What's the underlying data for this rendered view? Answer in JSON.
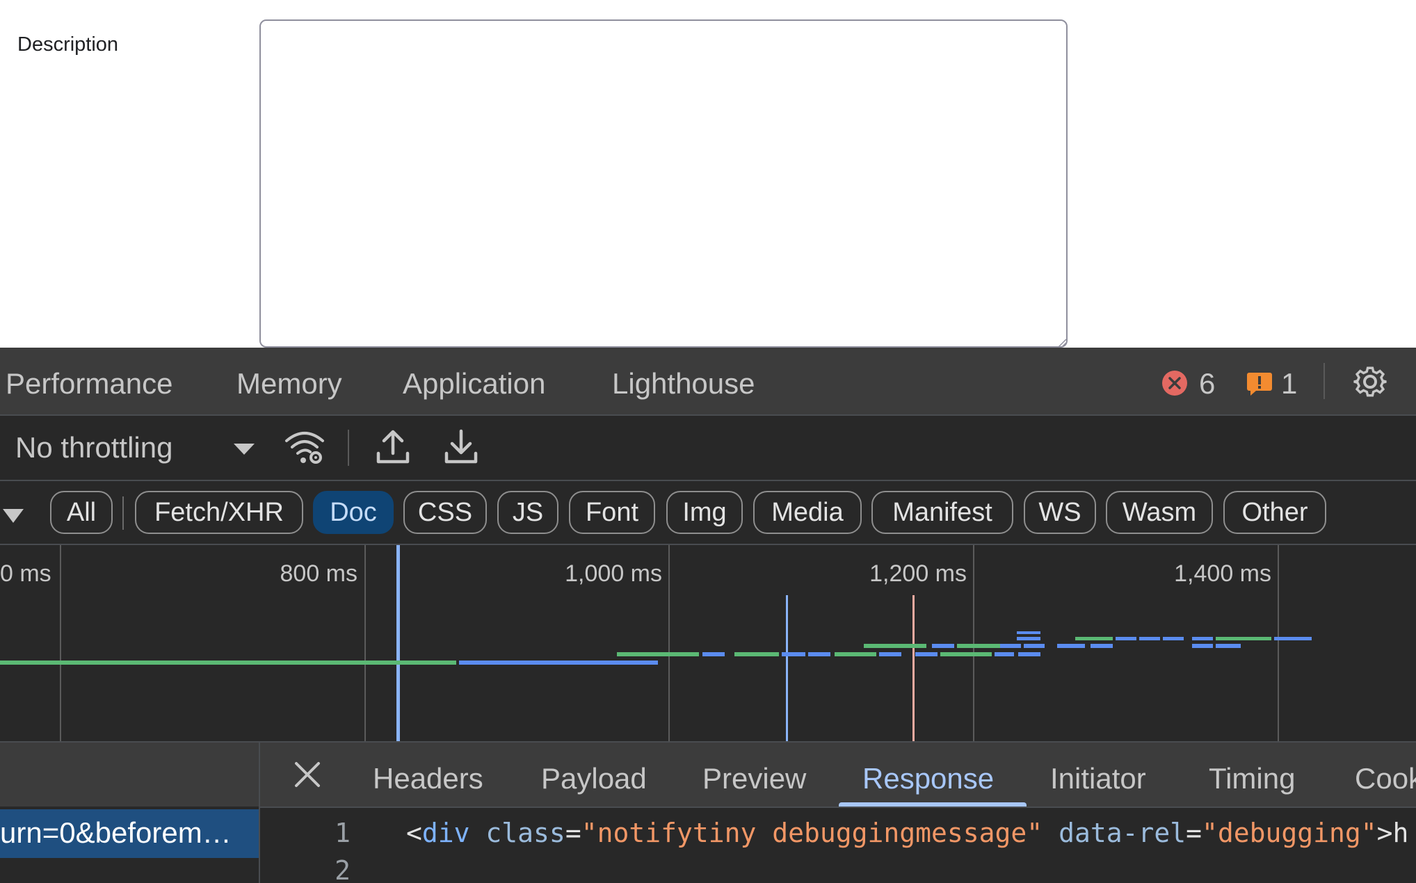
{
  "form": {
    "description_label": "Description",
    "description_value": ""
  },
  "devtools": {
    "main_tabs": [
      "Performance",
      "Memory",
      "Application",
      "Lighthouse"
    ],
    "error_count": "6",
    "warning_count": "1",
    "colors": {
      "error": "#e46962",
      "warning": "#f38b30",
      "accent": "#a8c7fa",
      "active_chip": "#0f4474"
    },
    "toolbar": {
      "throttling": "No throttling"
    },
    "filters": [
      "All",
      "Fetch/XHR",
      "Doc",
      "CSS",
      "JS",
      "Font",
      "Img",
      "Media",
      "Manifest",
      "WS",
      "Wasm",
      "Other"
    ],
    "active_filter": "Doc",
    "timeline": {
      "ticks": [
        "0 ms",
        "800 ms",
        "1,000 ms",
        "1,200 ms",
        "1,400 ms"
      ]
    },
    "request_list": {
      "selected_name": "urn=0&beforem…"
    },
    "detail_tabs": [
      "Headers",
      "Payload",
      "Preview",
      "Response",
      "Initiator",
      "Timing",
      "Cookies"
    ],
    "active_detail_tab": "Response",
    "response": {
      "line_numbers": [
        "1",
        "2"
      ],
      "line1": {
        "open": "<",
        "tag": "div",
        "attr1": "class",
        "eq": "=",
        "val1": "\"notifytiny debuggingmessage\"",
        "attr2": "data-rel",
        "val2": "\"debugging\"",
        "close": ">h"
      }
    }
  }
}
